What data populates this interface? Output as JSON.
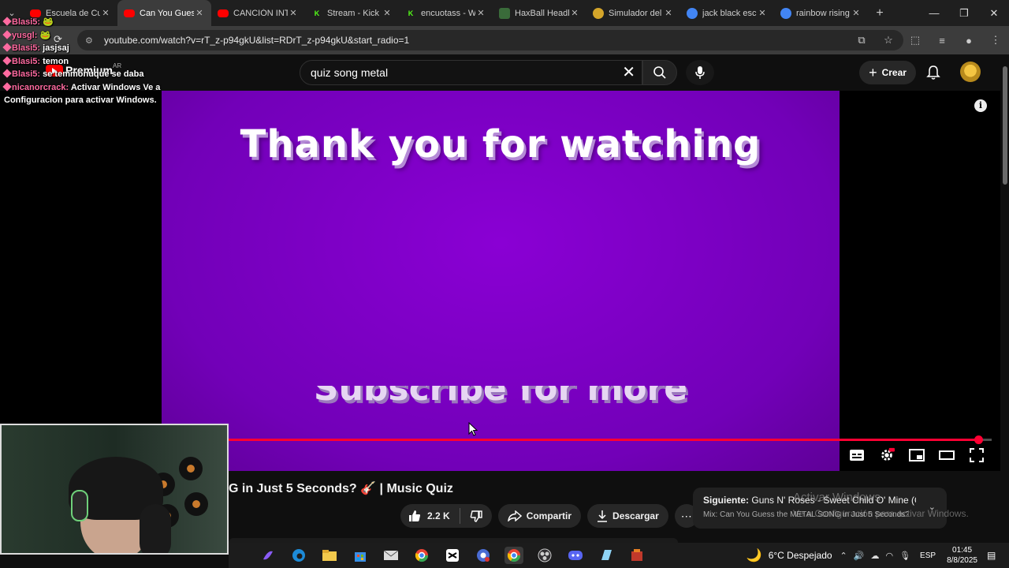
{
  "browser": {
    "tabs": [
      {
        "title": "Escuela de Cu",
        "favicon": "youtube-icon",
        "color": "#ff0000",
        "active": false
      },
      {
        "title": "Can You Gues",
        "favicon": "youtube-icon",
        "color": "#ff0000",
        "active": true
      },
      {
        "title": "CANCIÓN INT",
        "favicon": "youtube-icon",
        "color": "#ff0000",
        "active": false
      },
      {
        "title": "Stream - Kick",
        "favicon": "kick-icon",
        "color": "#53fc18",
        "active": false
      },
      {
        "title": "encuotass - W",
        "favicon": "kick-icon",
        "color": "#53fc18",
        "active": false
      },
      {
        "title": "HaxBall Headl",
        "favicon": "haxball-icon",
        "color": "#3a6b3a",
        "active": false
      },
      {
        "title": "Simulador del",
        "favicon": "coin-icon",
        "color": "#d4a52a",
        "active": false
      },
      {
        "title": "jack black esc",
        "favicon": "google-icon",
        "color": "#4285f4",
        "active": false
      },
      {
        "title": "rainbow rising",
        "favicon": "google-icon",
        "color": "#4285f4",
        "active": false
      }
    ],
    "url": "youtube.com/watch?v=rT_z-p94gkU&list=RDrT_z-p94gkU&start_radio=1"
  },
  "youtube": {
    "logo_text": "Premium",
    "country": "AR",
    "search_value": "quiz song metal",
    "create_label": "Crear"
  },
  "chat": [
    {
      "user": "Blasi5:",
      "msg": "🐸"
    },
    {
      "user": "yusgl:",
      "msg": "🐸"
    },
    {
      "user": "Blasi5:",
      "msg": "jasjsaj"
    },
    {
      "user": "Blasi5:",
      "msg": "temon"
    },
    {
      "user": "Blasi5:",
      "msg": "se temmonuque se daba"
    },
    {
      "user": "nicanorcrack:",
      "msg": "Activar Windows Ve a Configuracion para activar Windows."
    }
  ],
  "video": {
    "heading": "Thank you for watching",
    "footer_text": "Subscribe for more",
    "progress": 0.982,
    "title": "G in Just 5 Seconds? 🎸 | Music Quiz"
  },
  "actions": {
    "likes": "2.2 K",
    "share": "Compartir",
    "download": "Descargar"
  },
  "upnext": {
    "label": "Siguiente:",
    "title": "Guns N' Roses - Sweet Child O' Mine (Offi...",
    "mix": "Mix: Can You Guess the METAL SONG in Just 5 Seconds? ..."
  },
  "watermark": {
    "title": "Activar Windows",
    "subtitle": "Ve a Configuración para activar Windows."
  },
  "taskbar": {
    "weather": "6°C  Despejado",
    "lang": "ESP",
    "time": "01:45",
    "date": "8/8/2025"
  }
}
